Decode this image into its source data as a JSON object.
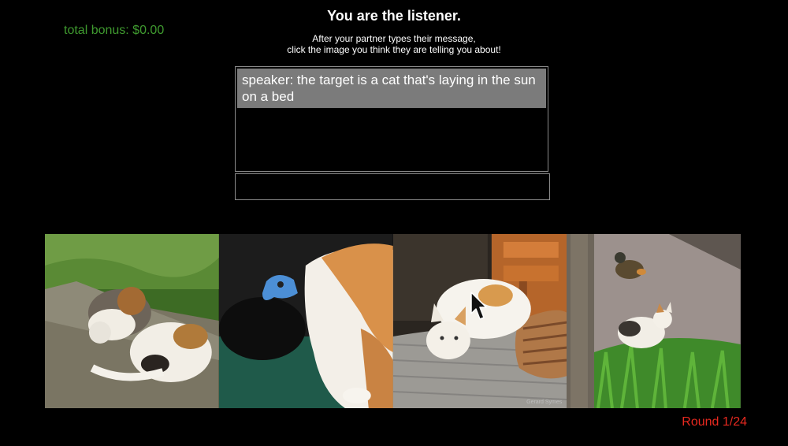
{
  "header": {
    "title": "You are the listener.",
    "instructions_line1": "After your partner types their message,",
    "instructions_line2": "click the image you think they are telling you about!"
  },
  "bonus": {
    "label": "total bonus: $0.00"
  },
  "chat": {
    "messages": [
      {
        "text": "speaker: the target is a cat that's laying in the sun on a bed"
      }
    ],
    "input_value": ""
  },
  "images": [
    {
      "name": "image-cats-cuddling-on-log"
    },
    {
      "name": "image-orange-cat-with-blue-toy"
    },
    {
      "name": "image-cat-laying-in-sun-on-bed",
      "watermark": "Gerard Symes"
    },
    {
      "name": "image-cat-in-grass-with-ducks"
    }
  ],
  "round": {
    "label": "Round 1/24"
  },
  "colors": {
    "bonus": "#3f9a2f",
    "round": "#e8291f",
    "message_bg": "#7b7b7b",
    "background": "#000000"
  }
}
